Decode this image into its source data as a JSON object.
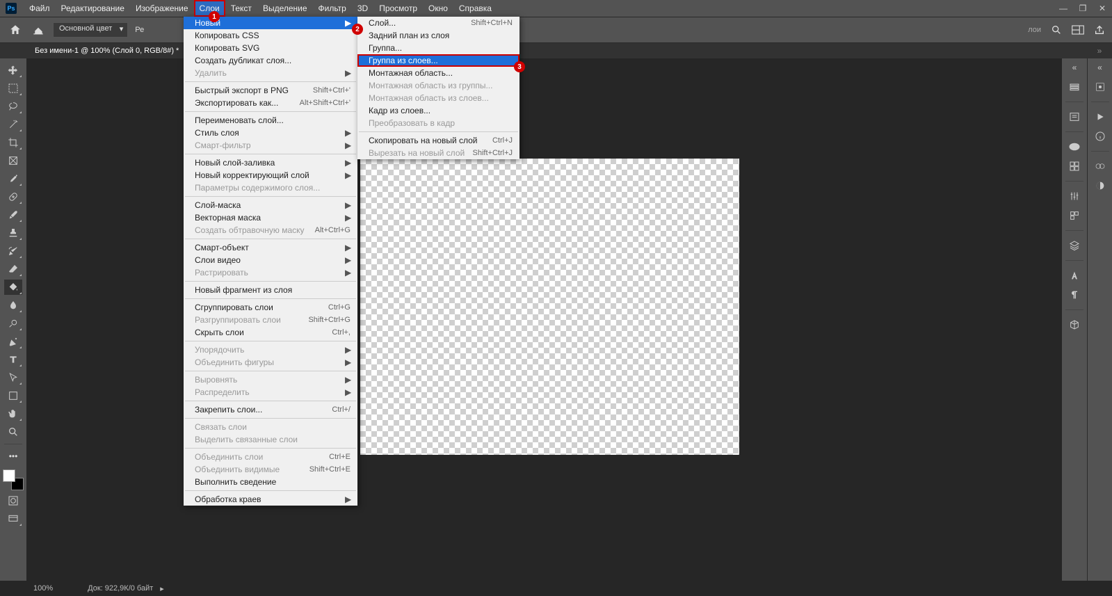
{
  "menubar": [
    "Файл",
    "Редактирование",
    "Изображение",
    "Слои",
    "Текст",
    "Выделение",
    "Фильтр",
    "3D",
    "Просмотр",
    "Окно",
    "Справка"
  ],
  "menubar_active_index": 3,
  "optionbar": {
    "fill_label": "Основной цвет",
    "rez": "Ре"
  },
  "doctab": {
    "title": "Без имени-1 @ 100% (Слой 0, RGB/8#) *"
  },
  "statusbar": {
    "zoom": "100%",
    "doc": "Док: 922,9К/0 байт"
  },
  "featured_text": "лои",
  "dropdown1": [
    {
      "t": "item",
      "label": "Новый",
      "sub": true,
      "hl": true
    },
    {
      "t": "item",
      "label": "Копировать CSS"
    },
    {
      "t": "item",
      "label": "Копировать SVG"
    },
    {
      "t": "item",
      "label": "Создать дубликат слоя..."
    },
    {
      "t": "item",
      "label": "Удалить",
      "sub": true,
      "dis": true
    },
    {
      "t": "sep"
    },
    {
      "t": "item",
      "label": "Быстрый экспорт в PNG",
      "shortcut": "Shift+Ctrl+'"
    },
    {
      "t": "item",
      "label": "Экспортировать как...",
      "shortcut": "Alt+Shift+Ctrl+'"
    },
    {
      "t": "sep"
    },
    {
      "t": "item",
      "label": "Переименовать слой..."
    },
    {
      "t": "item",
      "label": "Стиль слоя",
      "sub": true
    },
    {
      "t": "item",
      "label": "Смарт-фильтр",
      "sub": true,
      "dis": true
    },
    {
      "t": "sep"
    },
    {
      "t": "item",
      "label": "Новый слой-заливка",
      "sub": true
    },
    {
      "t": "item",
      "label": "Новый корректирующий слой",
      "sub": true
    },
    {
      "t": "item",
      "label": "Параметры содержимого слоя...",
      "dis": true
    },
    {
      "t": "sep"
    },
    {
      "t": "item",
      "label": "Слой-маска",
      "sub": true
    },
    {
      "t": "item",
      "label": "Векторная маска",
      "sub": true
    },
    {
      "t": "item",
      "label": "Создать обтравочную маску",
      "shortcut": "Alt+Ctrl+G",
      "dis": true
    },
    {
      "t": "sep"
    },
    {
      "t": "item",
      "label": "Смарт-объект",
      "sub": true
    },
    {
      "t": "item",
      "label": "Слои видео",
      "sub": true
    },
    {
      "t": "item",
      "label": "Растрировать",
      "sub": true,
      "dis": true
    },
    {
      "t": "sep"
    },
    {
      "t": "item",
      "label": "Новый фрагмент из слоя"
    },
    {
      "t": "sep"
    },
    {
      "t": "item",
      "label": "Сгруппировать слои",
      "shortcut": "Ctrl+G"
    },
    {
      "t": "item",
      "label": "Разгруппировать слои",
      "shortcut": "Shift+Ctrl+G",
      "dis": true
    },
    {
      "t": "item",
      "label": "Скрыть слои",
      "shortcut": "Ctrl+,"
    },
    {
      "t": "sep"
    },
    {
      "t": "item",
      "label": "Упорядочить",
      "sub": true,
      "dis": true
    },
    {
      "t": "item",
      "label": "Объединить фигуры",
      "sub": true,
      "dis": true
    },
    {
      "t": "sep"
    },
    {
      "t": "item",
      "label": "Выровнять",
      "sub": true,
      "dis": true
    },
    {
      "t": "item",
      "label": "Распределить",
      "sub": true,
      "dis": true
    },
    {
      "t": "sep"
    },
    {
      "t": "item",
      "label": "Закрепить слои...",
      "shortcut": "Ctrl+/"
    },
    {
      "t": "sep"
    },
    {
      "t": "item",
      "label": "Связать слои",
      "dis": true
    },
    {
      "t": "item",
      "label": "Выделить связанные слои",
      "dis": true
    },
    {
      "t": "sep"
    },
    {
      "t": "item",
      "label": "Объединить слои",
      "shortcut": "Ctrl+E",
      "dis": true
    },
    {
      "t": "item",
      "label": "Объединить видимые",
      "shortcut": "Shift+Ctrl+E",
      "dis": true
    },
    {
      "t": "item",
      "label": "Выполнить сведение"
    },
    {
      "t": "sep"
    },
    {
      "t": "item",
      "label": "Обработка краев",
      "sub": true
    }
  ],
  "dropdown2": [
    {
      "t": "item",
      "label": "Слой...",
      "shortcut": "Shift+Ctrl+N"
    },
    {
      "t": "item",
      "label": "Задний план из слоя"
    },
    {
      "t": "item",
      "label": "Группа..."
    },
    {
      "t": "item",
      "label": "Группа из слоев...",
      "hl": true,
      "outlined": true
    },
    {
      "t": "item",
      "label": "Монтажная область..."
    },
    {
      "t": "item",
      "label": "Монтажная область из группы...",
      "dis": true
    },
    {
      "t": "item",
      "label": "Монтажная область из слоев...",
      "dis": true
    },
    {
      "t": "item",
      "label": "Кадр из слоев..."
    },
    {
      "t": "item",
      "label": "Преобразовать в кадр",
      "dis": true
    },
    {
      "t": "sep"
    },
    {
      "t": "item",
      "label": "Скопировать на новый слой",
      "shortcut": "Ctrl+J"
    },
    {
      "t": "item",
      "label": "Вырезать на новый слой",
      "shortcut": "Shift+Ctrl+J",
      "dis": true
    }
  ],
  "annotations": [
    "1",
    "2",
    "3"
  ]
}
